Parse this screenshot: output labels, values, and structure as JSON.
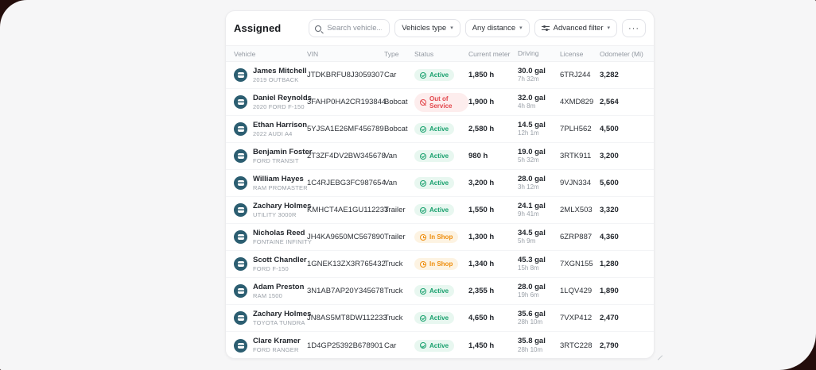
{
  "window": {
    "backdrop_color": "#230d0b",
    "surface_color": "#f6f6f7"
  },
  "panel": {
    "title": "Assigned",
    "search": {
      "placeholder": "Search vehicle..."
    },
    "filters": [
      {
        "label": "Vehicles type"
      },
      {
        "label": "Any distance"
      },
      {
        "label": "Advanced filter"
      }
    ],
    "caret_glyph": "▾",
    "more_glyph": "···"
  },
  "icons": {
    "search-icon": "css-magnifier",
    "sliders-icon": "css-dual-slider",
    "caret-down-icon": "▾",
    "ellipsis-icon": "···",
    "check-circle-icon": "css-circle-check",
    "ban-icon": "css-circle-slash",
    "clock-icon": "css-circle-clock",
    "vehicle-avatar-icon": "css-teal-circle-vehicle"
  },
  "colors": {
    "active_text": "#18a06d",
    "active_bg": "#e8f7f0",
    "out_of_service_text": "#e2474c",
    "out_of_service_bg": "#fdeded",
    "in_shop_text": "#ee8d0b",
    "in_shop_bg": "#fdf3e2",
    "avatar": "#2c5e71"
  },
  "table": {
    "columns": [
      "Vehicle",
      "VIN",
      "Type",
      "Status",
      "Current meter",
      "Driving",
      "License",
      "Odometer (Mi)"
    ],
    "rows": [
      {
        "driver": "James Mitchell",
        "vehicle": "2019 OUTBACK",
        "vin": "JTDKBRFU8J3059307",
        "type": "Car",
        "status": {
          "label": "Active",
          "kind": "active"
        },
        "meter": "1,850 h",
        "fuel": "30.0 gal",
        "time": "7h 32m",
        "license": "6TRJ244",
        "odometer": "3,282"
      },
      {
        "driver": "Daniel Reynolds",
        "vehicle": "2020 FORD F-150",
        "vin": "3FAHP0HA2CR193844",
        "type": "Bobcat",
        "status": {
          "label": "Out of Service",
          "kind": "out"
        },
        "meter": "1,900 h",
        "fuel": "32.0 gal",
        "time": "4h 8m",
        "license": "4XMD829",
        "odometer": "2,564"
      },
      {
        "driver": "Ethan Harrison",
        "vehicle": "2022 AUDI A4",
        "vin": "5YJSA1E26MF456789",
        "type": "Bobcat",
        "status": {
          "label": "Active",
          "kind": "active"
        },
        "meter": "2,580 h",
        "fuel": "14.5 gal",
        "time": "12h 1m",
        "license": "7PLH562",
        "odometer": "4,500"
      },
      {
        "driver": "Benjamin Foster",
        "vehicle": "FORD TRANSIT",
        "vin": "2T3ZF4DV2BW345678",
        "type": "Van",
        "status": {
          "label": "Active",
          "kind": "active"
        },
        "meter": "980 h",
        "fuel": "19.0 gal",
        "time": "5h 32m",
        "license": "3RTK911",
        "odometer": "3,200"
      },
      {
        "driver": "William Hayes",
        "vehicle": "RAM PROMASTER",
        "vin": "1C4RJEBG3FC987654",
        "type": "Van",
        "status": {
          "label": "Active",
          "kind": "active"
        },
        "meter": "3,200 h",
        "fuel": "28.0 gal",
        "time": "3h 12m",
        "license": "9VJN334",
        "odometer": "5,600"
      },
      {
        "driver": "Zachary Holmes",
        "vehicle": "UTILITY 3000R",
        "vin": "KMHCT4AE1GU112233",
        "type": "Trailer",
        "status": {
          "label": "Active",
          "kind": "active"
        },
        "meter": "1,550 h",
        "fuel": "24.1 gal",
        "time": "9h 41m",
        "license": "2MLX503",
        "odometer": "3,320"
      },
      {
        "driver": "Nicholas Reed",
        "vehicle": "FONTAINE INFINITY",
        "vin": "JH4KA9650MC567890",
        "type": "Trailer",
        "status": {
          "label": "In Shop",
          "kind": "shop"
        },
        "meter": "1,300 h",
        "fuel": "34.5 gal",
        "time": "5h 9m",
        "license": "6ZRP887",
        "odometer": "4,360"
      },
      {
        "driver": "Scott Chandler",
        "vehicle": "FORD F-150",
        "vin": "1GNEK13ZX3R765432",
        "type": "Truck",
        "status": {
          "label": "In Shop",
          "kind": "shop"
        },
        "meter": "1,340 h",
        "fuel": "45.3 gal",
        "time": "15h 8m",
        "license": "7XGN155",
        "odometer": "1,280"
      },
      {
        "driver": "Adam Preston",
        "vehicle": "RAM 1500",
        "vin": "3N1AB7AP20Y345678",
        "type": "Truck",
        "status": {
          "label": "Active",
          "kind": "active"
        },
        "meter": "2,355 h",
        "fuel": "28.0 gal",
        "time": "19h 6m",
        "license": "1LQV429",
        "odometer": "1,890"
      },
      {
        "driver": "Zachary Holmes",
        "vehicle": "TOYOTA TUNDRA",
        "vin": "JN8AS5MT8DW112233",
        "type": "Truck",
        "status": {
          "label": "Active",
          "kind": "active"
        },
        "meter": "4,650 h",
        "fuel": "35.6 gal",
        "time": "28h 10m",
        "license": "7VXP412",
        "odometer": "2,470"
      },
      {
        "driver": "Clare Kramer",
        "vehicle": "FORD RANGER",
        "vin": "1D4GP25392B678901",
        "type": "Car",
        "status": {
          "label": "Active",
          "kind": "active"
        },
        "meter": "1,450 h",
        "fuel": "35.8 gal",
        "time": "28h 10m",
        "license": "3RTC228",
        "odometer": "2,790"
      }
    ]
  }
}
